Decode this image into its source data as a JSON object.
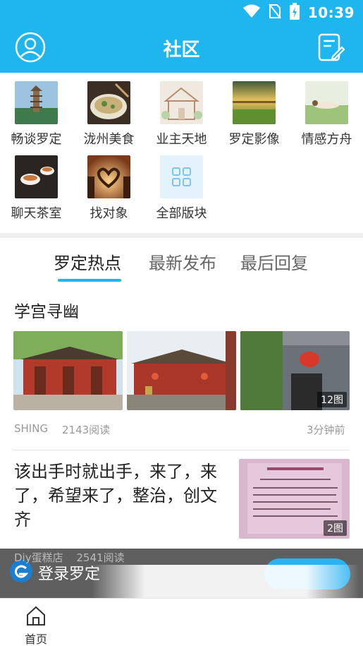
{
  "status_bar": {
    "time": "10:39"
  },
  "header": {
    "title": "社区"
  },
  "forums": [
    {
      "label": "畅谈罗定",
      "icon": "pagoda-photo"
    },
    {
      "label": "泷州美食",
      "icon": "food-bowl-photo"
    },
    {
      "label": "业主天地",
      "icon": "building-sketch-photo"
    },
    {
      "label": "罗定影像",
      "icon": "sunset-bridge-photo"
    },
    {
      "label": "情感方舟",
      "icon": "couple-grass-photo"
    },
    {
      "label": "聊天茶室",
      "icon": "tea-cups-photo"
    },
    {
      "label": "找对象",
      "icon": "heart-hands-photo"
    },
    {
      "label": "全部版块",
      "icon": "grid-icon"
    }
  ],
  "tabs": [
    {
      "label": "罗定热点",
      "active": true
    },
    {
      "label": "最新发布",
      "active": false
    },
    {
      "label": "最后回复",
      "active": false
    }
  ],
  "post1": {
    "title": "学宫寻幽",
    "image_count": "12图",
    "author": "SHING",
    "reads": "2143阅读",
    "time": "3分钟前"
  },
  "post2": {
    "title": "该出手时就出手，来了，来了，希望来了，整治，创文齐",
    "image_count": "2图"
  },
  "post3_meta": {
    "author": "Diy蛋糕店",
    "reads": "2541阅读"
  },
  "login_banner": {
    "text": "登录罗定"
  },
  "bottom_nav": {
    "home_label": "首页"
  },
  "colors": {
    "accent": "#1fb6f0",
    "text": "#222222",
    "muted": "#999999"
  }
}
